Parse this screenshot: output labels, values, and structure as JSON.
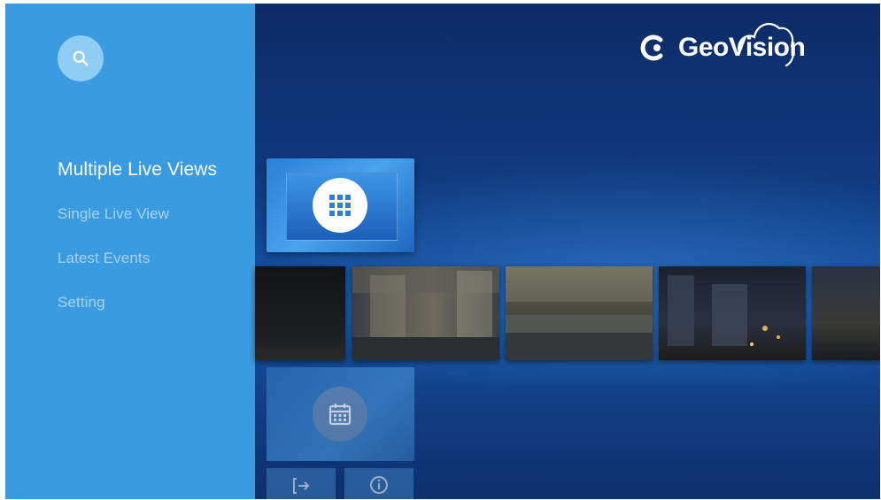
{
  "brand": {
    "name": "GeoVision"
  },
  "sidebar": {
    "search_icon": "search-icon",
    "items": [
      {
        "label": "Multiple Live Views",
        "active": true
      },
      {
        "label": "Single Live View",
        "active": false
      },
      {
        "label": "Latest Events",
        "active": false
      },
      {
        "label": "Setting",
        "active": false
      }
    ]
  },
  "cards": {
    "live_icon": "grid-icon",
    "events_icon": "calendar-icon",
    "logout_icon": "logout-icon",
    "info_icon": "info-icon"
  },
  "colors": {
    "sidebar": "#3a9be0",
    "accent": "#2b7fd8",
    "background": "#0f3a80"
  }
}
